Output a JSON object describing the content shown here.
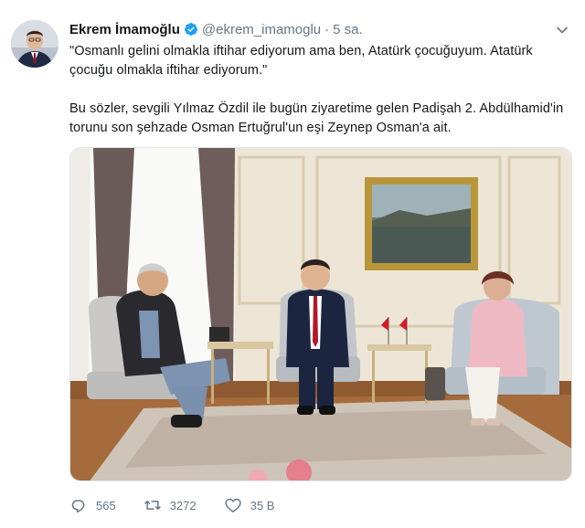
{
  "tweet": {
    "author_name": "Ekrem İmamoğlu",
    "handle": "@ekrem_imamoglu",
    "separator": "·",
    "time": "5 sa.",
    "paragraph1": "\"Osmanlı gelini olmakla iftihar ediyorum ama ben, Atatürk çocuğuyum. Atatürk çocuğu olmakla iftihar ediyorum.\"",
    "paragraph2": "Bu sözler, sevgili Yılmaz Özdil ile bugün ziyaretime gelen Padişah 2. Abdülhamid'in torunu son şehzade Osman Ertuğrul'un eşi Zeynep Osman'a ait."
  },
  "actions": {
    "replies": "565",
    "retweets": "3272",
    "likes": "35 B"
  },
  "colors": {
    "text_primary": "#14171a",
    "text_secondary": "#657786",
    "verified_blue": "#1da1f2"
  },
  "icons": [
    "verified-badge-icon",
    "chevron-down-icon",
    "reply-icon",
    "retweet-icon",
    "like-icon"
  ]
}
